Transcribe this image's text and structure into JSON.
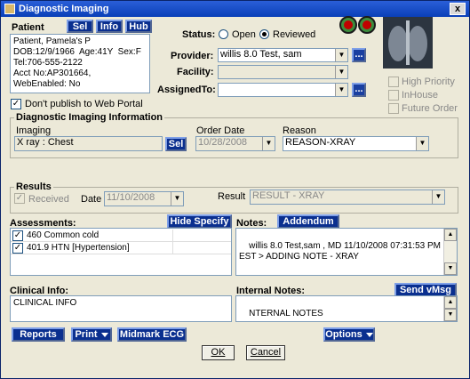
{
  "window": {
    "title": "Diagnostic Imaging",
    "close": "x"
  },
  "patient": {
    "label": "Patient",
    "lines": "Patient, Pamela's P\nDOB:12/9/1966  Age:41Y  Sex:F\nTel:706-555-2122\nAcct No:AP301664,\nWebEnabled: No"
  },
  "header_buttons": {
    "sel": "Sel",
    "info": "Info",
    "hub": "Hub"
  },
  "status": {
    "label": "Status:",
    "open": "Open",
    "reviewed": "Reviewed",
    "selected": "Reviewed"
  },
  "provider": {
    "label": "Provider:",
    "value": "willis 8.0 Test, sam"
  },
  "facility": {
    "label": "Facility:",
    "value": ""
  },
  "assigned": {
    "label": "AssignedTo:",
    "value": ""
  },
  "dots": "...",
  "dont_publish": {
    "label": "Don't publish to Web Portal",
    "checked": true
  },
  "flags": {
    "high_priority": "High Priority",
    "inhouse": "InHouse",
    "future_order": "Future Order"
  },
  "dii": {
    "title": "Diagnostic Imaging Information",
    "imaging_label": "Imaging",
    "imaging_value": "X ray :  Chest",
    "sel": "Sel",
    "order_date_label": "Order Date",
    "order_date_value": "10/28/2008",
    "reason_label": "Reason",
    "reason_value": "REASON-XRAY"
  },
  "results": {
    "title": "Results",
    "received": "Received",
    "date_label": "Date",
    "date_value": "11/10/2008",
    "result_label": "Result",
    "result_value": "RESULT - XRAY"
  },
  "assessments": {
    "label": "Assessments:",
    "hide_specify": "Hide Specify",
    "rows": [
      {
        "text": "460  Common cold",
        "checked": true
      },
      {
        "text": "401.9  HTN [Hypertension]",
        "checked": true
      }
    ]
  },
  "notes": {
    "label": "Notes:",
    "addendum": "Addendum",
    "text": "willis 8.0 Test,sam , MD 11/10/2008 07:31:53 PM\nEST > ADDING NOTE - XRAY"
  },
  "clinical": {
    "label": "Clinical Info:",
    "text": "CLINICAL INFO"
  },
  "internal": {
    "label": "Internal Notes:",
    "send": "Send vMsg",
    "text": "NTERNAL NOTES"
  },
  "bottom": {
    "reports": "Reports",
    "print": "Print",
    "midmark": "Midmark ECG",
    "options": "Options",
    "ok": "OK",
    "cancel": "Cancel"
  },
  "colors": {
    "title_bar": "#0a3fb8",
    "button_blue": "#0a2f8f",
    "window_bg": "#ece9d8"
  }
}
